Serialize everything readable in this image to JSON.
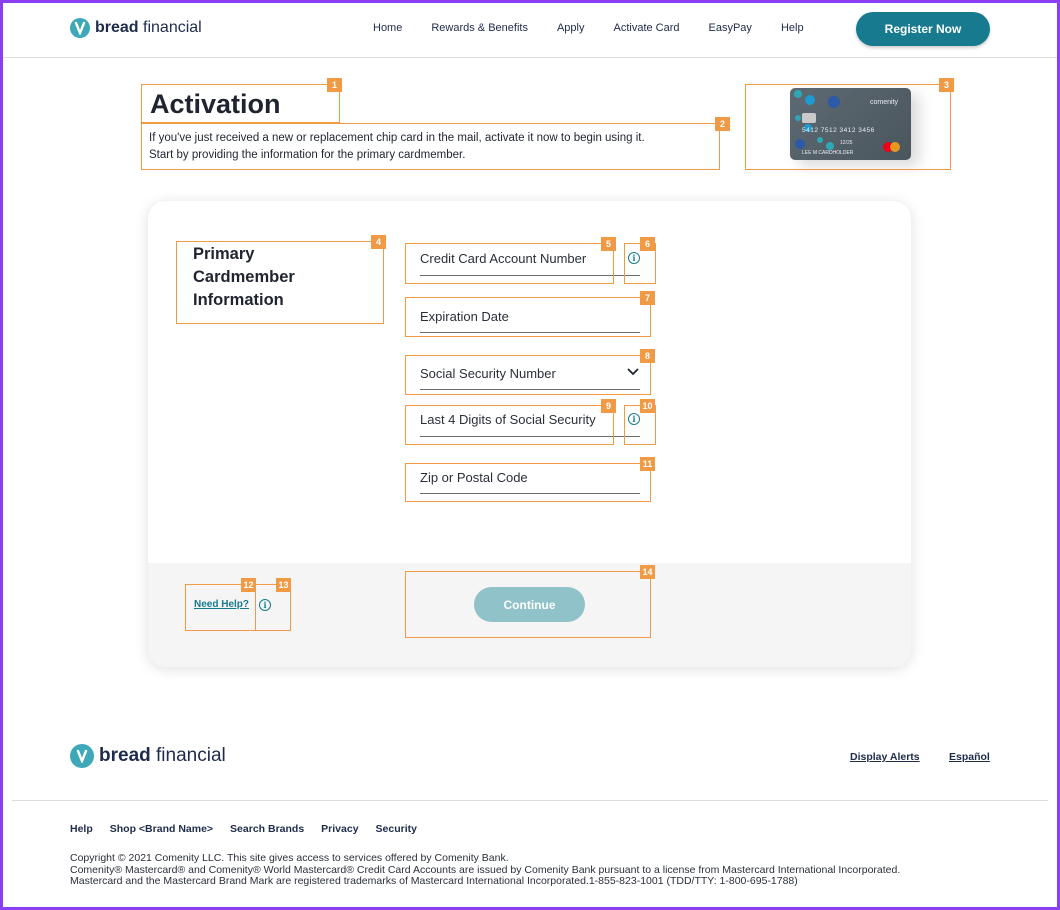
{
  "header": {
    "logo_bold": "bread",
    "logo_light": "financial",
    "nav": [
      "Home",
      "Rewards & Benefits",
      "Apply",
      "Activate Card",
      "EasyPay",
      "Help"
    ],
    "register_label": "Register Now"
  },
  "page": {
    "title": "Activation",
    "intro_line1": "If you've just received a new or replacement chip card in the mail, activate it now to begin using it.",
    "intro_line2": "Start by providing the information for the primary cardmember."
  },
  "card_image": {
    "brand": "comenity",
    "number_text": "5412 7512 3412 3456",
    "name_text": "LEE M CARDHOLDER",
    "valid_text": "12/25"
  },
  "form": {
    "section_title_1": "Primary",
    "section_title_2": "Cardmember",
    "section_title_3": "Information",
    "fields": [
      "Credit Card Account Number",
      "Expiration Date",
      "Social Security Number",
      "Last 4 Digits of Social Security",
      "Zip or Postal Code"
    ],
    "info_glyph": "i",
    "need_help": "Need Help?",
    "continue": "Continue"
  },
  "annotations": [
    "1",
    "2",
    "3",
    "4",
    "5",
    "6",
    "7",
    "8",
    "9",
    "10",
    "11",
    "12",
    "13",
    "14"
  ],
  "footer": {
    "logo_bold": "bread",
    "logo_light": "financial",
    "display_alerts": "Display Alerts",
    "espanol": "Español",
    "links": [
      "Help",
      "Shop <Brand Name>",
      "Search Brands",
      "Privacy",
      "Security"
    ],
    "copy1": "Copyright © 2021 Comenity LLC. This site gives access to services offered by Comenity Bank.",
    "copy2": "Comenity® Mastercard® and Comenity® World Mastercard® Credit Card Accounts are issued by Comenity Bank pursuant to a license from Mastercard International Incorporated.",
    "copy3": "Mastercard and the Mastercard Brand Mark are registered trademarks of Mastercard International Incorporated.1-855-823-1001 (TDD/TTY: 1-800-695-1788)"
  },
  "colors": {
    "accent": "#177a8f",
    "annotation": "#f19a45",
    "continue_disabled": "#8fc2c9",
    "text": "#1f2430"
  }
}
